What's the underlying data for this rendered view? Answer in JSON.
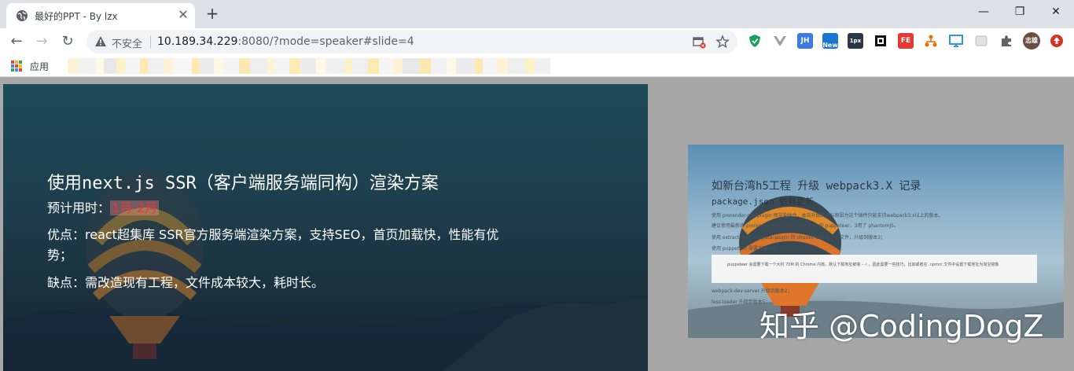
{
  "browser": {
    "tab": {
      "title": "最好的PPT - By lzx",
      "close_glyph": "✕"
    },
    "new_tab_glyph": "+",
    "window_controls": {
      "minimize": "—",
      "maximize": "❐",
      "close": "✕"
    },
    "toolbar": {
      "back": "←",
      "forward": "→",
      "reload": "↻"
    },
    "omnibox": {
      "security_label": "不安全",
      "url_host": "10.189.34.229",
      "url_rest": ":8080/?mode=speaker#slide=4"
    },
    "extensions": [
      {
        "name": "shield-extension",
        "label": "",
        "color": "#1aa260"
      },
      {
        "name": "vue-devtools-extension",
        "label": "",
        "color": "#9e9e9e"
      },
      {
        "name": "jh-extension",
        "label": "JH",
        "color": "#3d7be0"
      },
      {
        "name": "new-extension",
        "label": "New",
        "color": "#1976d2"
      },
      {
        "name": "1px-extension",
        "label": "1px",
        "color": "#283845"
      },
      {
        "name": "square-extension",
        "label": "",
        "color": "#111111"
      },
      {
        "name": "fe-extension",
        "label": "FE",
        "color": "#e53935"
      },
      {
        "name": "tree-extension",
        "label": "",
        "color": "#ef6c00"
      },
      {
        "name": "screen-extension",
        "label": "",
        "color": "#1e88e5"
      },
      {
        "name": "grey-extension",
        "label": "",
        "color": "#cfcfcf"
      },
      {
        "name": "puzzle-extension",
        "label": "",
        "color": "#5f6368"
      },
      {
        "name": "profile-avatar",
        "label": "志雄",
        "color": "#6d4c41"
      },
      {
        "name": "update-extension",
        "label": "",
        "color": "#d93025"
      }
    ]
  },
  "bookmarks": {
    "apps_label": "应用",
    "apps_dot_colors": [
      "#ea4335",
      "#fbbc05",
      "#34a853",
      "#4285f4",
      "#ea4335",
      "#fbbc05",
      "#34a853",
      "#4285f4",
      "#ea4335"
    ]
  },
  "slide": {
    "title": "使用next.js SSR（客户端服务端同构）渲染方案",
    "time_label": "预计用时：",
    "time_value": "1月-2月",
    "pros_line1": "优点：react超集库 SSR官方服务端渲染方案，支持SEO，首页加载快，性能有优",
    "pros_line2": "势；",
    "cons": "缺点：需改造现有工程，文件成本较大，耗时长。"
  },
  "preview": {
    "title": "如新台湾h5工程 升级 webpack3.X 记录",
    "subtitle": "package.json 依赖更新",
    "line1": "使用 prerender-spa-plugin 预渲染插件，本次升级的目标原因为这个插件只能支持webpack3.x以上的版本。",
    "line2": "建议使用最新的 prerender 插件，2用了 Chrome 的 puppeteer，3用了 phantomJS。",
    "line3": "使用 extract-text-webpack-plugin 的 chunks 抽离出 css 文件，升级到版本3；",
    "line4": "使用 puppeteer 需要下载内核；",
    "code": "puppeteer 会需要下载一个大约 70M 的 Chrome 内核，默认下载地址被墙 - -! ，因此需要一些技巧，比如或者在 .npmrc 文件中设置下载地址为淘宝镜像",
    "line5": "webpack-dev-server 升级到版本2；",
    "line6": "less-loader 升级到版本5；"
  },
  "watermark": "知乎 @CodingDogZ"
}
